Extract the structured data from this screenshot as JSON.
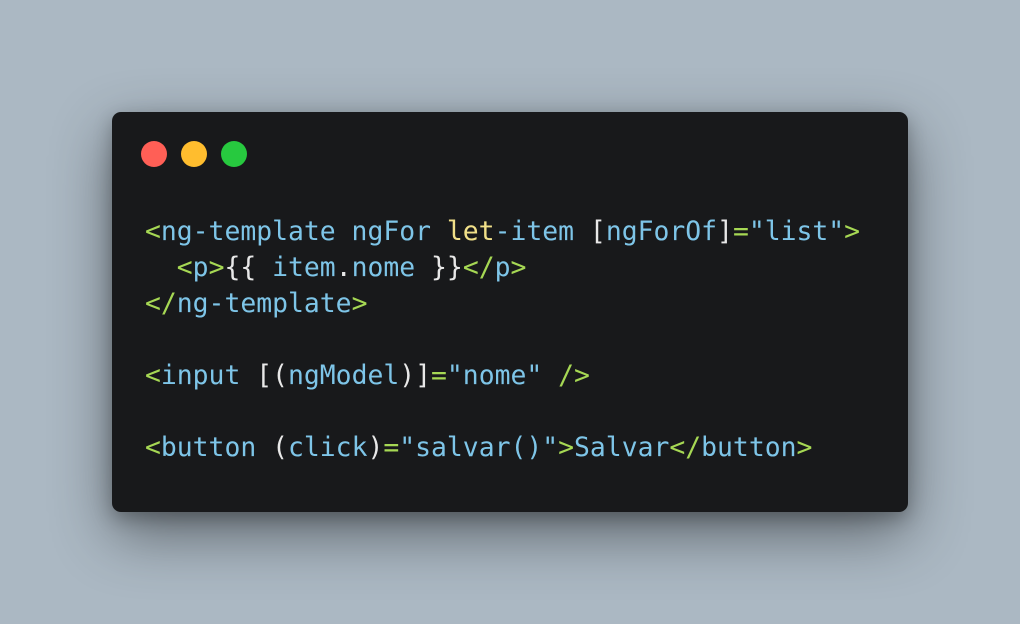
{
  "window": {
    "buttons": [
      {
        "name": "close",
        "color": "#ff5f56"
      },
      {
        "name": "minimize",
        "color": "#ffbd2e"
      },
      {
        "name": "maximize",
        "color": "#27c93f"
      }
    ]
  },
  "theme": {
    "text": "#e8e8e8",
    "tag": "#7ec5e8",
    "bracket": "#a6d854",
    "keyword": "#f1e089",
    "string": "#7ec5e8"
  },
  "code": {
    "lines": [
      [
        {
          "t": "<",
          "c": "bracket"
        },
        {
          "t": "ng-template",
          "c": "tag"
        },
        {
          "t": " ngFor ",
          "c": "tag"
        },
        {
          "t": "let",
          "c": "keyword"
        },
        {
          "t": "-item ",
          "c": "tag"
        },
        {
          "t": "[",
          "c": "text"
        },
        {
          "t": "ngForOf",
          "c": "tag"
        },
        {
          "t": "]",
          "c": "text"
        },
        {
          "t": "=",
          "c": "bracket"
        },
        {
          "t": "\"list\"",
          "c": "string"
        },
        {
          "t": ">",
          "c": "bracket"
        }
      ],
      [
        {
          "t": "  <",
          "c": "bracket"
        },
        {
          "t": "p",
          "c": "tag"
        },
        {
          "t": ">",
          "c": "bracket"
        },
        {
          "t": "{{ ",
          "c": "text"
        },
        {
          "t": "item",
          "c": "tag"
        },
        {
          "t": ".",
          "c": "text"
        },
        {
          "t": "nome",
          "c": "tag"
        },
        {
          "t": " }}",
          "c": "text"
        },
        {
          "t": "</",
          "c": "bracket"
        },
        {
          "t": "p",
          "c": "tag"
        },
        {
          "t": ">",
          "c": "bracket"
        }
      ],
      [
        {
          "t": "</",
          "c": "bracket"
        },
        {
          "t": "ng-template",
          "c": "tag"
        },
        {
          "t": ">",
          "c": "bracket"
        }
      ],
      [],
      [
        {
          "t": "<",
          "c": "bracket"
        },
        {
          "t": "input",
          "c": "tag"
        },
        {
          "t": " [(",
          "c": "text"
        },
        {
          "t": "ngModel",
          "c": "tag"
        },
        {
          "t": ")]",
          "c": "text"
        },
        {
          "t": "=",
          "c": "bracket"
        },
        {
          "t": "\"nome\"",
          "c": "string"
        },
        {
          "t": " />",
          "c": "bracket"
        }
      ],
      [],
      [
        {
          "t": "<",
          "c": "bracket"
        },
        {
          "t": "button",
          "c": "tag"
        },
        {
          "t": " (",
          "c": "text"
        },
        {
          "t": "click",
          "c": "tag"
        },
        {
          "t": ")",
          "c": "text"
        },
        {
          "t": "=",
          "c": "bracket"
        },
        {
          "t": "\"salvar()\"",
          "c": "string"
        },
        {
          "t": ">",
          "c": "bracket"
        },
        {
          "t": "Salvar",
          "c": "tag"
        },
        {
          "t": "</",
          "c": "bracket"
        },
        {
          "t": "button",
          "c": "tag"
        },
        {
          "t": ">",
          "c": "bracket"
        }
      ]
    ]
  }
}
